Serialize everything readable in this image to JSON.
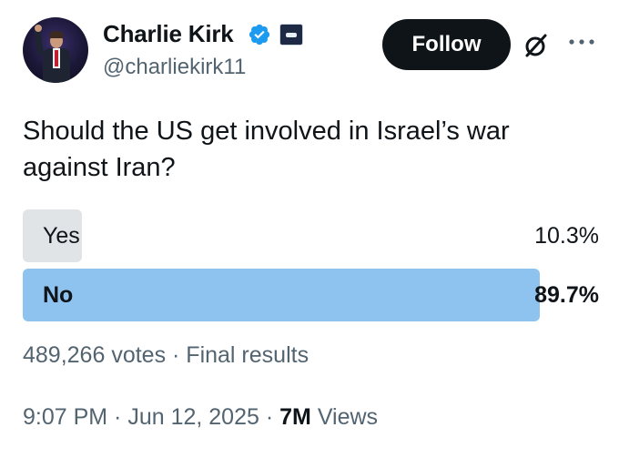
{
  "author": {
    "name": "Charlie Kirk",
    "handle": "@charliekirk11",
    "verified": true,
    "verified_color": "#1d9bf0"
  },
  "actions": {
    "follow_label": "Follow",
    "grok_icon": "grok-icon",
    "more_icon": "more-icon"
  },
  "tweet": {
    "text": "Should the US get involved in Israel’s war against Iran?"
  },
  "poll": {
    "options": [
      {
        "label": "Yes",
        "percent_text": "10.3%",
        "percent": 10.3,
        "winner": false,
        "color": "#e0e4e7"
      },
      {
        "label": "No",
        "percent_text": "89.7%",
        "percent": 89.7,
        "winner": true,
        "color": "#8ec3f0"
      }
    ],
    "votes_text": "489,266 votes",
    "separator": " · ",
    "status": "Final results"
  },
  "meta": {
    "time": "9:07 PM",
    "date": "Jun 12, 2025",
    "separator": " · ",
    "views_count": "7M",
    "views_label": "Views"
  }
}
